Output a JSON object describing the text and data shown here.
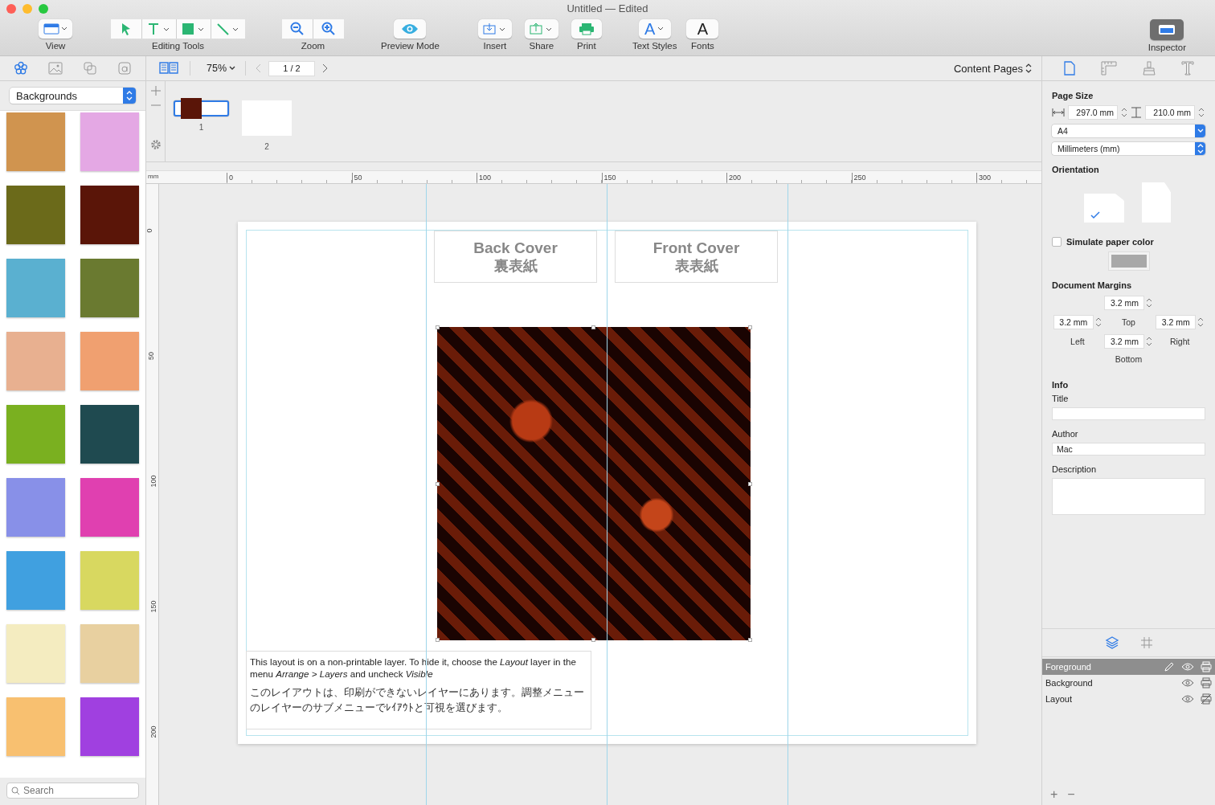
{
  "window": {
    "title": "Untitled — Edited"
  },
  "toolbar": {
    "items": [
      {
        "kind": "view",
        "label": "View"
      },
      {
        "kind": "editing",
        "label": "Editing Tools"
      },
      {
        "kind": "zoom",
        "label": "Zoom"
      },
      {
        "kind": "preview",
        "label": "Preview Mode"
      },
      {
        "kind": "insert",
        "label": "Insert"
      },
      {
        "kind": "share",
        "label": "Share"
      },
      {
        "kind": "print",
        "label": "Print"
      },
      {
        "kind": "text_styles",
        "label": "Text Styles",
        "glyph": "A"
      },
      {
        "kind": "fonts",
        "label": "Fonts",
        "glyph": "A"
      },
      {
        "kind": "inspector",
        "label": "Inspector"
      }
    ]
  },
  "library": {
    "tabs": [
      {
        "kind": "flower",
        "selected": true
      },
      {
        "kind": "image",
        "selected": false
      },
      {
        "kind": "shapes",
        "selected": false
      },
      {
        "kind": "text",
        "selected": false
      }
    ],
    "category": "Backgrounds",
    "swatches": [
      {
        "color": "#d0944f"
      },
      {
        "color": "#e4a8e4"
      },
      {
        "color": "#6b6a1a"
      },
      {
        "color": "#5a1508"
      },
      {
        "color": "#5ab0d0"
      },
      {
        "color": "#6a7a30"
      },
      {
        "color": "#e8b090"
      },
      {
        "color": "#f0a070"
      },
      {
        "color": "#7ab020"
      },
      {
        "color": "#1f4a50"
      },
      {
        "color": "#8890e8"
      },
      {
        "color": "#e040b0"
      },
      {
        "color": "#40a0e0"
      },
      {
        "color": "#d8d860"
      },
      {
        "color": "#f4ecc0"
      },
      {
        "color": "#e8d0a0"
      },
      {
        "color": "#f8c070"
      },
      {
        "color": "#a040e0"
      }
    ],
    "search": {
      "placeholder": "Search"
    }
  },
  "nav": {
    "zoom": "75%",
    "page": "1 / 2",
    "section": "Content Pages"
  },
  "pages": [
    {
      "label": "1",
      "selected": true
    },
    {
      "label": "2",
      "selected": false
    }
  ],
  "ruler": {
    "unit": "mm",
    "h_ticks": [
      "0",
      "50",
      "100",
      "150",
      "200",
      "250",
      "300"
    ],
    "v_ticks": [
      "0",
      "50",
      "100",
      "150",
      "200"
    ]
  },
  "document": {
    "covers": [
      {
        "title": "Back Cover",
        "subtitle": "裏表紙"
      },
      {
        "title": "Front Cover",
        "subtitle": "表表紙"
      }
    ],
    "note": {
      "english": "This layout is on a non-printable layer. To hide it, choose the *Layout* layer in the menu *Arrange > Layers* and uncheck *Visible*",
      "japanese": "このレイアウトは、印刷ができないレイヤーにあります。調整メニューのレイヤーのサブメニューでﾚｲｱｳﾄと可視を選びます。"
    }
  },
  "inspector": {
    "tabs": [
      {
        "kind": "document",
        "selected": true
      },
      {
        "kind": "ruler",
        "selected": false
      },
      {
        "kind": "brush",
        "selected": false
      },
      {
        "kind": "text",
        "selected": false
      }
    ],
    "page_size": {
      "heading": "Page Size",
      "width": "297.0 mm",
      "height": "210.0 mm",
      "preset": "A4",
      "units": "Millimeters (mm)"
    },
    "orientation": {
      "heading": "Orientation",
      "options": [
        {
          "kind": "landscape",
          "selected": true
        },
        {
          "kind": "portrait",
          "selected": false
        }
      ]
    },
    "paper_color": {
      "label": "Simulate paper color",
      "checked": false
    },
    "margins": {
      "heading": "Document Margins",
      "top": {
        "value": "3.2 mm",
        "label": "Top"
      },
      "left": {
        "value": "3.2 mm",
        "label": "Left"
      },
      "right": {
        "value": "3.2 mm",
        "label": "Right"
      },
      "bottom": {
        "value": "3.2 mm",
        "label": "Bottom"
      }
    },
    "info": {
      "heading": "Info",
      "fields": [
        {
          "kind": "line",
          "label": "Title"
        },
        {
          "kind": "line",
          "label": "Author",
          "value": "Mac"
        },
        {
          "kind": "area",
          "label": "Description"
        }
      ]
    },
    "panel_tabs": [
      {
        "kind": "layers",
        "selected": true
      },
      {
        "kind": "grid",
        "selected": false
      }
    ],
    "layers": [
      {
        "name": "Foreground",
        "selected": true,
        "editable": true,
        "printable": true
      },
      {
        "name": "Background",
        "selected": false,
        "editable": false,
        "printable": true
      },
      {
        "name": "Layout",
        "selected": false,
        "editable": false,
        "printable": false
      }
    ],
    "layer_buttons": [
      "+",
      "−"
    ]
  }
}
